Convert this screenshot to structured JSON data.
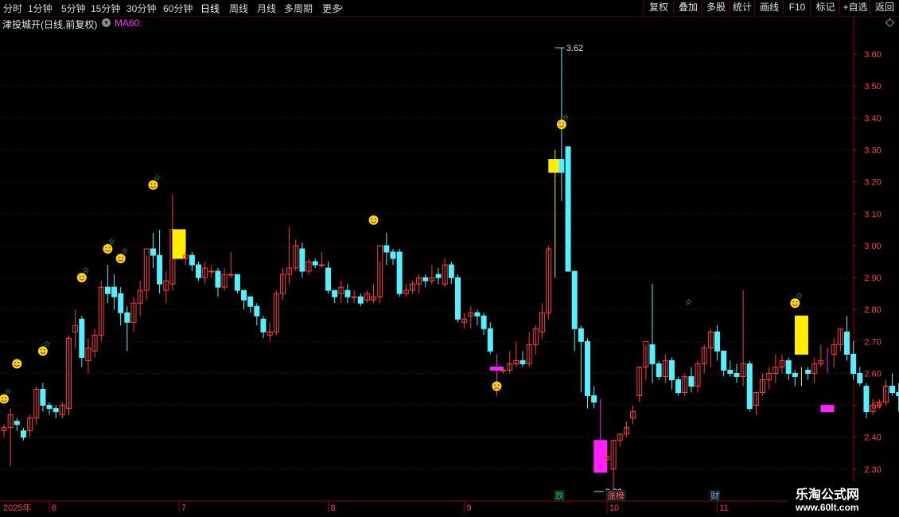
{
  "toolbar": {
    "periods": [
      "分时",
      "1分钟",
      "5分钟",
      "15分钟",
      "30分钟",
      "60分钟",
      "日线",
      "周线",
      "月线",
      "多周期",
      "更多"
    ],
    "active_period": "日线",
    "right_buttons": [
      "复权",
      "叠加",
      "多股",
      "统计",
      "画线",
      "F10",
      "标记",
      "+自选",
      "返回"
    ]
  },
  "info": {
    "stock_title": "津投城开(日线,前复权)",
    "ma_label": "MA60:"
  },
  "colors": {
    "up": "#ff3b3b",
    "down": "#54f0ff",
    "grid": "#7a0000",
    "axis_text": "#ff4040",
    "highlight_yellow": "#ffee00",
    "highlight_magenta": "#ff22ff"
  },
  "chart_data": {
    "type": "candlestick",
    "y_ticks": [
      2.3,
      2.4,
      2.5,
      2.6,
      2.7,
      2.8,
      2.9,
      3.0,
      3.1,
      3.2,
      3.3,
      3.4,
      3.5,
      3.6
    ],
    "ylim": [
      2.2,
      3.67
    ],
    "x_labels": [
      {
        "label": "2025年",
        "index": 0
      },
      {
        "label": "6",
        "index": 7
      },
      {
        "label": "7",
        "index": 27
      },
      {
        "label": "8",
        "index": 50
      },
      {
        "label": "9",
        "index": 71
      },
      {
        "label": "10",
        "index": 93
      },
      {
        "label": "11",
        "index": 110
      }
    ],
    "candles": [
      [
        2.42,
        2.44,
        2.4,
        2.43
      ],
      [
        2.43,
        2.49,
        2.31,
        2.47
      ],
      [
        2.45,
        2.46,
        2.42,
        2.44
      ],
      [
        2.42,
        2.43,
        2.39,
        2.4
      ],
      [
        2.42,
        2.47,
        2.4,
        2.46
      ],
      [
        2.46,
        2.56,
        2.44,
        2.55
      ],
      [
        2.55,
        2.57,
        2.48,
        2.5
      ],
      [
        2.5,
        2.51,
        2.47,
        2.49
      ],
      [
        2.49,
        2.5,
        2.46,
        2.48
      ],
      [
        2.47,
        2.51,
        2.46,
        2.5
      ],
      [
        2.49,
        2.72,
        2.47,
        2.71
      ],
      [
        2.73,
        2.8,
        2.68,
        2.75
      ],
      [
        2.77,
        2.78,
        2.62,
        2.65
      ],
      [
        2.64,
        2.71,
        2.6,
        2.68
      ],
      [
        2.67,
        2.74,
        2.65,
        2.72
      ],
      [
        2.72,
        2.89,
        2.7,
        2.87
      ],
      [
        2.87,
        2.94,
        2.82,
        2.85
      ],
      [
        2.87,
        2.91,
        2.8,
        2.84
      ],
      [
        2.85,
        2.87,
        2.75,
        2.79
      ],
      [
        2.79,
        2.81,
        2.67,
        2.76
      ],
      [
        2.76,
        2.84,
        2.73,
        2.82
      ],
      [
        2.82,
        2.89,
        2.78,
        2.86
      ],
      [
        2.86,
        2.97,
        2.83,
        2.99
      ],
      [
        2.99,
        3.04,
        2.93,
        2.97
      ],
      [
        2.97,
        3.05,
        2.85,
        2.88
      ],
      [
        2.86,
        2.92,
        2.82,
        2.89
      ],
      [
        2.88,
        3.16,
        2.86,
        3.05
      ],
      [
        3.05,
        3.05,
        2.96,
        2.96
      ],
      [
        2.96,
        2.98,
        2.94,
        2.97
      ],
      [
        2.97,
        2.98,
        2.92,
        2.94
      ],
      [
        2.94,
        2.95,
        2.89,
        2.9
      ],
      [
        2.9,
        2.95,
        2.88,
        2.93
      ],
      [
        2.92,
        2.94,
        2.9,
        2.92
      ],
      [
        2.92,
        2.93,
        2.84,
        2.87
      ],
      [
        2.87,
        2.93,
        2.86,
        2.91
      ],
      [
        2.91,
        2.98,
        2.9,
        2.91
      ],
      [
        2.91,
        2.91,
        2.85,
        2.86
      ],
      [
        2.86,
        2.86,
        2.8,
        2.83
      ],
      [
        2.84,
        2.84,
        2.79,
        2.81
      ],
      [
        2.81,
        2.82,
        2.75,
        2.78
      ],
      [
        2.77,
        2.78,
        2.71,
        2.73
      ],
      [
        2.72,
        2.76,
        2.7,
        2.73
      ],
      [
        2.73,
        2.86,
        2.72,
        2.85
      ],
      [
        2.85,
        2.93,
        2.83,
        2.91
      ],
      [
        2.91,
        3.06,
        2.88,
        2.93
      ],
      [
        2.93,
        3.02,
        2.92,
        3.0
      ],
      [
        2.99,
        3.01,
        2.9,
        2.92
      ],
      [
        2.92,
        2.96,
        2.91,
        2.95
      ],
      [
        2.95,
        2.96,
        2.93,
        2.94
      ],
      [
        2.94,
        2.98,
        2.93,
        2.94
      ],
      [
        2.93,
        2.95,
        2.85,
        2.86
      ],
      [
        2.86,
        2.86,
        2.82,
        2.84
      ],
      [
        2.85,
        2.89,
        2.82,
        2.87
      ],
      [
        2.86,
        2.88,
        2.82,
        2.84
      ],
      [
        2.84,
        2.86,
        2.82,
        2.84
      ],
      [
        2.84,
        2.85,
        2.81,
        2.82
      ],
      [
        2.83,
        2.86,
        2.82,
        2.85
      ],
      [
        2.83,
        2.88,
        2.82,
        2.84
      ],
      [
        2.84,
        2.95,
        2.82,
        3.0
      ],
      [
        3.0,
        3.04,
        2.94,
        2.98
      ],
      [
        2.98,
        2.99,
        2.94,
        2.96
      ],
      [
        2.98,
        2.99,
        2.84,
        2.85
      ],
      [
        2.85,
        2.88,
        2.84,
        2.86
      ],
      [
        2.86,
        2.89,
        2.85,
        2.88
      ],
      [
        2.88,
        2.91,
        2.85,
        2.9
      ],
      [
        2.9,
        2.91,
        2.87,
        2.89
      ],
      [
        2.89,
        2.94,
        2.88,
        2.9
      ],
      [
        2.91,
        2.93,
        2.88,
        2.9
      ],
      [
        2.88,
        2.96,
        2.87,
        2.94
      ],
      [
        2.94,
        2.95,
        2.88,
        2.9
      ],
      [
        2.9,
        2.91,
        2.76,
        2.77
      ],
      [
        2.76,
        2.79,
        2.74,
        2.77
      ],
      [
        2.78,
        2.81,
        2.74,
        2.79
      ],
      [
        2.79,
        2.8,
        2.75,
        2.78
      ],
      [
        2.78,
        2.79,
        2.72,
        2.74
      ],
      [
        2.74,
        2.76,
        2.66,
        2.67
      ],
      [
        2.65,
        2.66,
        2.53,
        2.61
      ],
      [
        2.61,
        2.62,
        2.6,
        2.61
      ],
      [
        2.61,
        2.67,
        2.6,
        2.63
      ],
      [
        2.63,
        2.7,
        2.62,
        2.64
      ],
      [
        2.64,
        2.67,
        2.62,
        2.63
      ],
      [
        2.63,
        2.73,
        2.62,
        2.69
      ],
      [
        2.69,
        2.75,
        2.66,
        2.74
      ],
      [
        2.73,
        2.82,
        2.71,
        2.79
      ],
      [
        2.79,
        3.0,
        2.77,
        2.99
      ],
      [
        2.99,
        3.3,
        2.9,
        3.3
      ],
      [
        3.27,
        3.62,
        3.14,
        3.23
      ],
      [
        3.31,
        3.31,
        2.93,
        2.92
      ],
      [
        2.92,
        2.8,
        2.67,
        2.74
      ],
      [
        2.74,
        2.75,
        2.54,
        2.7
      ],
      [
        2.7,
        2.71,
        2.49,
        2.53
      ],
      [
        2.53,
        2.56,
        2.49,
        2.51
      ],
      [
        2.51,
        2.52,
        2.32,
        2.35
      ],
      [
        2.33,
        2.36,
        2.31,
        2.34
      ],
      [
        2.3,
        2.39,
        2.23,
        2.39
      ],
      [
        2.39,
        2.41,
        2.37,
        2.41
      ],
      [
        2.41,
        2.45,
        2.4,
        2.43
      ],
      [
        2.46,
        2.5,
        2.44,
        2.48
      ],
      [
        2.53,
        2.62,
        2.51,
        2.62
      ],
      [
        2.62,
        2.69,
        2.58,
        2.7
      ],
      [
        2.69,
        2.88,
        2.57,
        2.63
      ],
      [
        2.63,
        2.64,
        2.58,
        2.59
      ],
      [
        2.59,
        2.66,
        2.57,
        2.64
      ],
      [
        2.64,
        2.65,
        2.55,
        2.58
      ],
      [
        2.58,
        2.59,
        2.53,
        2.54
      ],
      [
        2.54,
        2.6,
        2.53,
        2.59
      ],
      [
        2.59,
        2.62,
        2.54,
        2.56
      ],
      [
        2.56,
        2.64,
        2.54,
        2.63
      ],
      [
        2.63,
        2.69,
        2.6,
        2.68
      ],
      [
        2.68,
        2.74,
        2.62,
        2.73
      ],
      [
        2.73,
        2.75,
        2.64,
        2.67
      ],
      [
        2.67,
        2.67,
        2.59,
        2.61
      ],
      [
        2.61,
        2.64,
        2.59,
        2.6
      ],
      [
        2.6,
        2.63,
        2.57,
        2.59
      ],
      [
        2.59,
        2.86,
        2.56,
        2.63
      ],
      [
        2.63,
        2.64,
        2.48,
        2.49
      ],
      [
        2.5,
        2.54,
        2.47,
        2.54
      ],
      [
        2.54,
        2.6,
        2.53,
        2.58
      ],
      [
        2.58,
        2.62,
        2.55,
        2.6
      ],
      [
        2.6,
        2.66,
        2.57,
        2.62
      ],
      [
        2.62,
        2.66,
        2.6,
        2.64
      ],
      [
        2.64,
        2.65,
        2.58,
        2.6
      ],
      [
        2.6,
        2.61,
        2.56,
        2.59
      ],
      [
        2.59,
        2.62,
        2.56,
        2.61
      ],
      [
        2.61,
        2.62,
        2.58,
        2.6
      ],
      [
        2.6,
        2.65,
        2.57,
        2.63
      ],
      [
        2.63,
        2.69,
        2.62,
        2.64
      ],
      [
        2.64,
        2.68,
        2.6,
        2.66
      ],
      [
        2.66,
        2.71,
        2.62,
        2.69
      ],
      [
        2.69,
        2.74,
        2.67,
        2.74
      ],
      [
        2.73,
        2.78,
        2.64,
        2.66
      ],
      [
        2.66,
        2.7,
        2.58,
        2.6
      ],
      [
        2.6,
        2.62,
        2.56,
        2.57
      ],
      [
        2.56,
        2.57,
        2.46,
        2.48
      ],
      [
        2.48,
        2.52,
        2.47,
        2.5
      ],
      [
        2.5,
        2.52,
        2.49,
        2.51
      ],
      [
        2.51,
        2.58,
        2.5,
        2.56
      ],
      [
        2.56,
        2.6,
        2.53,
        2.54
      ],
      [
        2.54,
        2.57,
        2.48,
        2.53
      ],
      [
        2.53,
        2.59,
        2.52,
        2.58
      ]
    ],
    "highlights": [
      {
        "index": 27,
        "color": "yellow",
        "open": 3.05,
        "close": 2.96
      },
      {
        "index": 85,
        "color": "yellow",
        "open": 3.27,
        "close": 3.23
      },
      {
        "index": 92,
        "color": "magenta",
        "open": 2.39,
        "close": 2.29
      },
      {
        "index": 123,
        "color": "yellow",
        "open": 2.78,
        "close": 2.66
      },
      {
        "index": 76,
        "color": "magenta",
        "open": 2.62,
        "close": 2.61
      },
      {
        "index": 127,
        "color": "magenta",
        "open": 2.5,
        "close": 2.48
      }
    ],
    "markers": [
      {
        "index": 0,
        "price": 2.52,
        "kind": "smile",
        "star": true
      },
      {
        "index": 2,
        "price": 2.63,
        "kind": "smile",
        "star": false
      },
      {
        "index": 6,
        "price": 2.67,
        "kind": "smile",
        "star": true
      },
      {
        "index": 12,
        "price": 2.9,
        "kind": "smile",
        "star": true
      },
      {
        "index": 16,
        "price": 2.99,
        "kind": "smile",
        "star": true
      },
      {
        "index": 18,
        "price": 2.96,
        "kind": "smile",
        "star": true
      },
      {
        "index": 23,
        "price": 3.19,
        "kind": "smile",
        "star": true
      },
      {
        "index": 57,
        "price": 3.08,
        "kind": "smile",
        "star": false
      },
      {
        "index": 76,
        "price": 2.56,
        "kind": "frown",
        "star": false
      },
      {
        "index": 86,
        "price": 3.38,
        "kind": "smile",
        "star": true
      },
      {
        "index": 105,
        "price": 2.8,
        "kind": "none",
        "star": true
      },
      {
        "index": 122,
        "price": 2.82,
        "kind": "smile",
        "star": true
      }
    ],
    "extremes": [
      {
        "label": "3.62",
        "price": 3.62,
        "index": 85
      },
      {
        "label": "2.23",
        "price": 2.23,
        "index": 92
      }
    ],
    "event_tags": [
      {
        "label": "跌",
        "index": 85,
        "color": "#00cc44"
      },
      {
        "label": "涨榜",
        "index": 93,
        "color": "#ff6666"
      },
      {
        "label": "财",
        "index": 109,
        "color": "#66aaff"
      }
    ]
  },
  "watermark": {
    "line1": "乐淘公式网",
    "line2": "www.60lt.com"
  }
}
